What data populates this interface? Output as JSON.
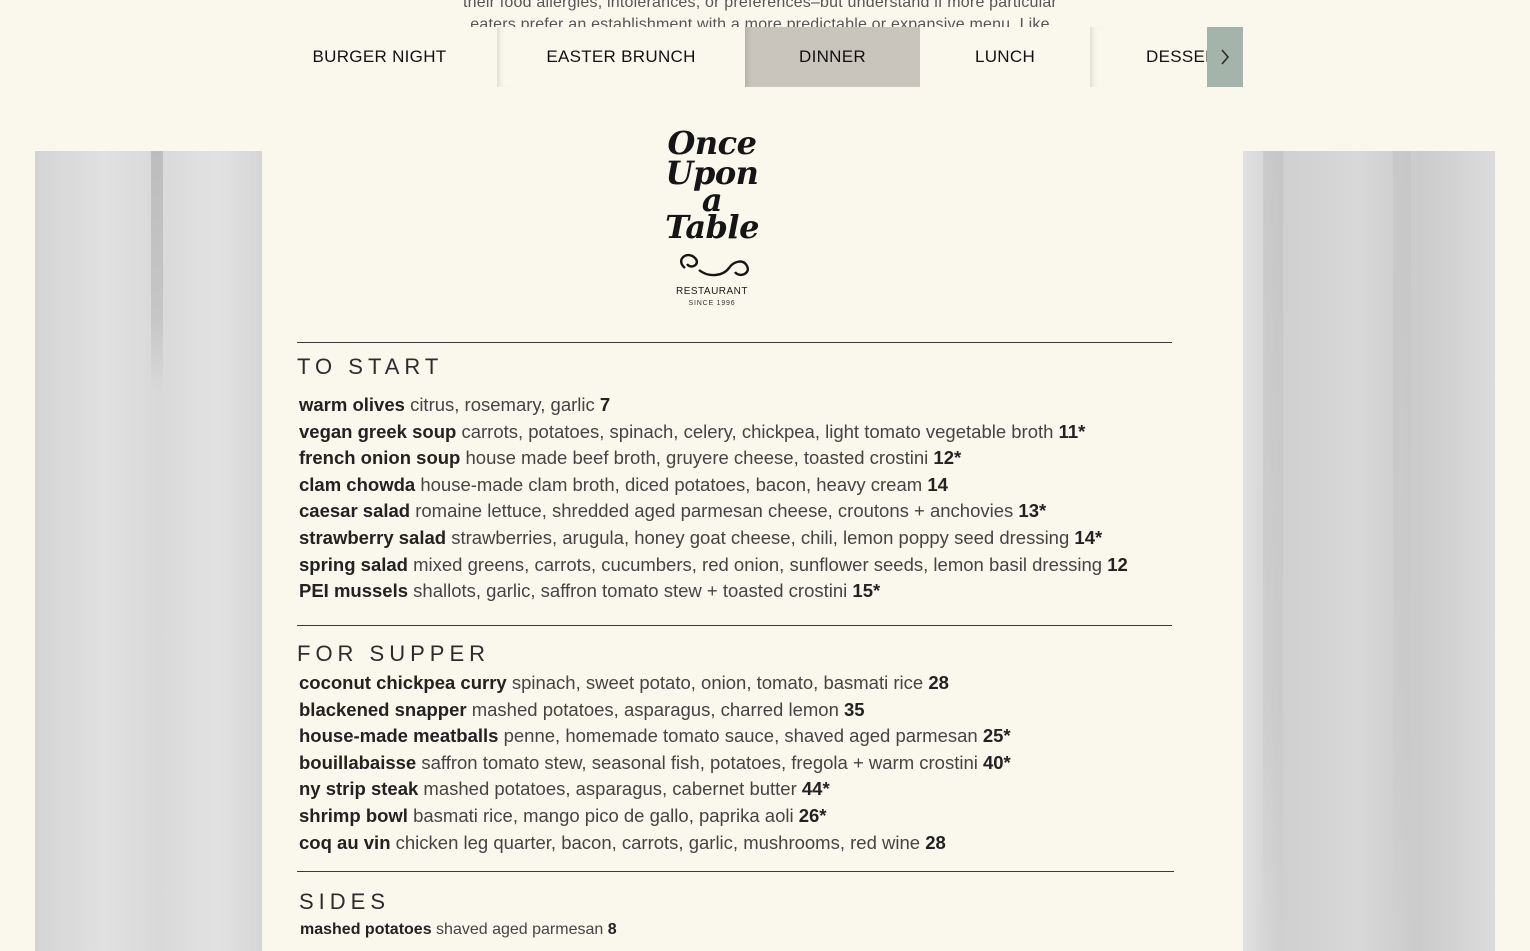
{
  "intro": {
    "line1": "their food allergies, intolerances, or preferences–but understand if more particular",
    "line2": "eaters prefer an establishment with a more predictable or expansive menu. Like"
  },
  "tabs": [
    {
      "label": "BURGER NIGHT"
    },
    {
      "label": "EASTER BRUNCH"
    },
    {
      "label": "DINNER",
      "active": true
    },
    {
      "label": "LUNCH"
    },
    {
      "label": "DESSERT"
    }
  ],
  "tab_next_icon": "chevron-right-icon",
  "logo": {
    "w1": "Once",
    "w2": "Upon",
    "w3": "a",
    "w4": "Table",
    "sub": "RESTAURANT",
    "since": "SINCE 1996"
  },
  "sections": [
    {
      "title": "TO START",
      "items": [
        {
          "name": "warm olives",
          "desc": "citrus, rosemary, garlic",
          "price": "7"
        },
        {
          "name": "vegan greek soup",
          "desc": "carrots, potatoes, spinach, celery, chickpea, light tomato vegetable broth",
          "price": "11*"
        },
        {
          "name": "french onion soup",
          "desc": "house made beef broth, gruyere cheese, toasted crostini",
          "price": "12*"
        },
        {
          "name": "clam chowda",
          "desc": "house-made clam broth, diced potatoes, bacon, heavy cream",
          "price": "14"
        },
        {
          "name": "caesar salad",
          "desc": "romaine lettuce, shredded aged parmesan cheese, croutons + anchovies",
          "price": "13*"
        },
        {
          "name": "strawberry salad",
          "desc": "strawberries, arugula, honey goat cheese, chili, lemon poppy seed dressing",
          "price": "14*"
        },
        {
          "name": "spring salad",
          "desc": "mixed greens, carrots, cucumbers, red onion, sunflower seeds, lemon basil dressing",
          "price": "12"
        },
        {
          "name": "PEI mussels",
          "desc": "shallots, garlic, saffron tomato stew + toasted crostini",
          "price": "15*"
        }
      ]
    },
    {
      "title": "FOR SUPPER",
      "items": [
        {
          "name": "coconut chickpea curry",
          "desc": "spinach, sweet potato, onion, tomato, basmati rice",
          "price": "28"
        },
        {
          "name": "blackened snapper",
          "desc": "mashed potatoes, asparagus, charred lemon",
          "price": "35"
        },
        {
          "name": "house-made meatballs",
          "desc": "penne, homemade tomato sauce, shaved aged parmesan",
          "price": "25*"
        },
        {
          "name": "bouillabaisse",
          "desc": "saffron tomato stew, seasonal fish, potatoes, fregola + warm crostini",
          "price": "40*"
        },
        {
          "name": "ny strip steak",
          "desc": "mashed potatoes, asparagus, cabernet butter",
          "price": "44*"
        },
        {
          "name": "shrimp bowl",
          "desc": "basmati rice, mango pico de gallo, paprika aoli",
          "price": "26*"
        },
        {
          "name": "coq au vin",
          "desc": "chicken leg quarter, bacon, carrots, garlic, mushrooms, red wine",
          "price": "28"
        }
      ]
    },
    {
      "title": "SIDES",
      "items": [
        {
          "name": "mashed potatoes",
          "desc": "shaved aged parmesan",
          "price": "8"
        }
      ]
    }
  ]
}
